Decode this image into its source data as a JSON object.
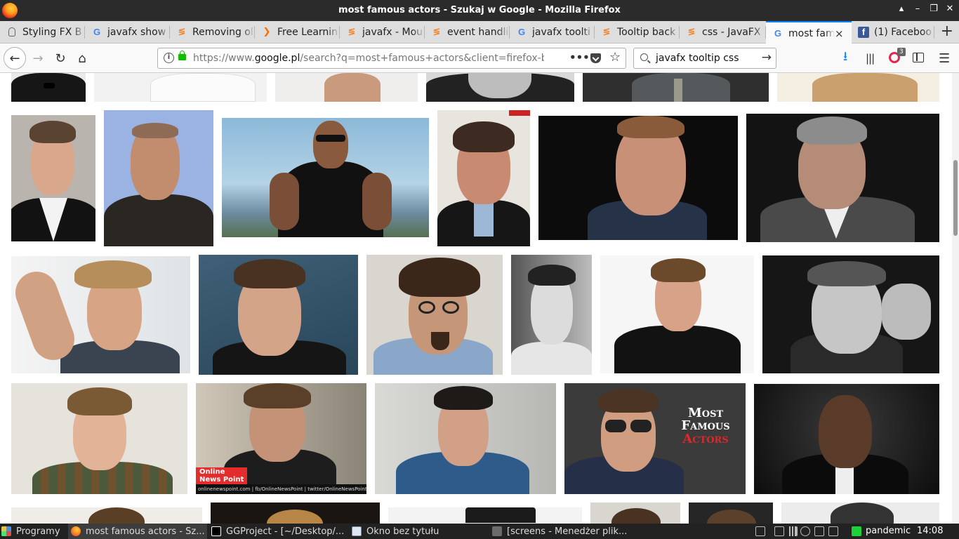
{
  "window": {
    "title": "most famous actors - Szukaj w Google - Mozilla Firefox"
  },
  "tabs": [
    {
      "label": "Styling FX B",
      "icon": "bulb-icon"
    },
    {
      "label": "javafx show",
      "icon": "google-icon"
    },
    {
      "label": "Removing ol",
      "icon": "stackoverflow-icon"
    },
    {
      "label": "Free Learnin",
      "icon": "freecodecamp-icon"
    },
    {
      "label": "javafx - Mou",
      "icon": "stackoverflow-icon"
    },
    {
      "label": "event handli",
      "icon": "stackoverflow-icon"
    },
    {
      "label": "javafx toolti",
      "icon": "google-icon"
    },
    {
      "label": "Tooltip back",
      "icon": "stackoverflow-icon"
    },
    {
      "label": "css - JavaFX",
      "icon": "stackoverflow-icon"
    },
    {
      "label": "most fam",
      "icon": "google-icon",
      "active": true
    },
    {
      "label": "(1) Faceboo",
      "icon": "facebook-icon"
    }
  ],
  "glyphs": {
    "google": "G",
    "so": "≶",
    "fcc": "❯",
    "fb": "f",
    "close": "×",
    "newtab": "+",
    "back": "←",
    "fwd": "→",
    "reload": "↻",
    "home": "⌂",
    "info": "i",
    "dots": "•••",
    "star": "☆",
    "go": "→",
    "download": "⭳",
    "library": "|||",
    "menu": "☰",
    "min": "▴",
    "minimize": "–",
    "maximize": "❐",
    "closewin": "✕"
  },
  "navbar": {
    "url_prefix": "https://www.",
    "url_domain": "google.pl",
    "url_rest": "/search?q=most+famous+actors&client=firefox-b-ab&",
    "search_value": "javafx tooltip css",
    "badge_count": "3"
  },
  "results": {
    "thumbnail_labels": {
      "most_famous_actors": "Most Famous Actors",
      "line1": "Most",
      "line2": "Famous",
      "line3": "Actors"
    },
    "online_news_point": {
      "tag": "Online",
      "tag2": "News Point",
      "strip": "onlinenewspoint.com | fb/OnlineNewsPoint | twitter/OnlineNewsPoint"
    }
  },
  "taskbar": {
    "start_label": "Programy",
    "tasks": [
      {
        "label": "most famous actors - Sz...",
        "icon": "firefox-icon",
        "active": true
      },
      {
        "label": "GGProject - [~/Desktop/...",
        "icon": "intellij-icon"
      },
      {
        "label": "Okno bez tytułu",
        "icon": "window-icon"
      },
      {
        "label": "[screens - Menedżer plik...",
        "icon": "folder-icon"
      }
    ],
    "workspace": "pandemic",
    "clock": "14:08"
  },
  "colors": {
    "accent": "#0a84ff",
    "tab_active_border": "#0a84ff",
    "lock": "#12bc00",
    "title_bg": "#2b2b2b",
    "taskbar_bg": "#222222"
  }
}
